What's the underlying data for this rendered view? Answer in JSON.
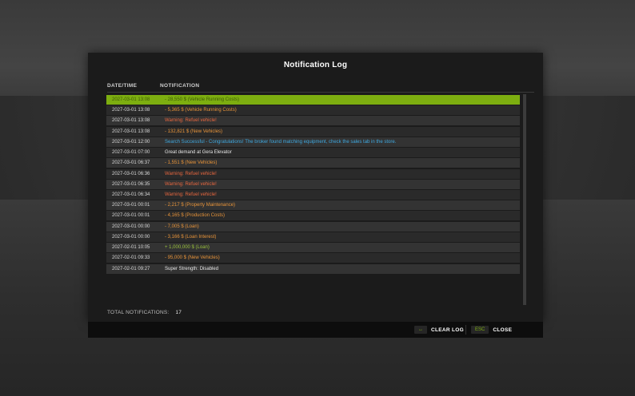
{
  "dialog": {
    "title": "Notification Log",
    "columns": {
      "date": "DATE/TIME",
      "notification": "NOTIFICATION"
    }
  },
  "colors": {
    "accent": "#7dae10",
    "white": "#e6e6e6",
    "expense": "#e8943a",
    "warning": "#e8673f",
    "info": "#3fa9e0",
    "income": "#9ac23c"
  },
  "notifications": [
    {
      "date": "2027-03-01 13:08",
      "message": "- 28,550 $ (Vehicle Running Costs)",
      "kind": "selected"
    },
    {
      "date": "2027-03-01 13:08",
      "message": "- 5,365 $ (Vehicle Running Costs)",
      "kind": "expense"
    },
    {
      "date": "2027-03-01 13:08",
      "message": "Warning: Refuel vehicle!",
      "kind": "warning"
    },
    {
      "date": "2027-03-01 13:08",
      "message": "- 132,821 $ (New Vehicles)",
      "kind": "expense"
    },
    {
      "date": "2027-03-01 12:00",
      "message": "Search Successful - Congratulations! The broker found matching equipment, check the sales tab in the store.",
      "kind": "info"
    },
    {
      "date": "2027-03-01 07:00",
      "message": "Great demand at Gera Elevator",
      "kind": "plain"
    },
    {
      "date": "2027-03-01 06:37",
      "message": "- 1,551 $ (New Vehicles)",
      "kind": "expense"
    },
    {
      "date": "2027-03-01 06:36",
      "message": "Warning: Refuel vehicle!",
      "kind": "warning"
    },
    {
      "date": "2027-03-01 06:35",
      "message": "Warning: Refuel vehicle!",
      "kind": "warning"
    },
    {
      "date": "2027-03-01 06:34",
      "message": "Warning: Refuel vehicle!",
      "kind": "warning"
    },
    {
      "date": "2027-03-01 00:01",
      "message": "- 2,217 $ (Property Maintenance)",
      "kind": "expense"
    },
    {
      "date": "2027-03-01 00:01",
      "message": "- 4,165 $ (Production Costs)",
      "kind": "expense"
    },
    {
      "date": "2027-03-01 00:00",
      "message": "- 7,005 $ (Loan)",
      "kind": "expense"
    },
    {
      "date": "2027-03-01 00:00",
      "message": "- 3,166 $ (Loan Interest)",
      "kind": "expense"
    },
    {
      "date": "2027-02-01 10:05",
      "message": "+ 1,000,000 $ (Loan)",
      "kind": "income"
    },
    {
      "date": "2027-02-01 09:33",
      "message": "- 95,000 $ (New Vehicles)",
      "kind": "expense"
    },
    {
      "date": "2027-02-01 09:27",
      "message": "Super Strength: Disabled",
      "kind": "plain"
    }
  ],
  "total": {
    "label": "TOTAL NOTIFICATIONS:",
    "value": "17"
  },
  "footer": {
    "clear": {
      "key_icon": "↔",
      "key_icon_name": "arrows-horizontal-icon",
      "label": "CLEAR LOG"
    },
    "close": {
      "key": "ESC",
      "label": "CLOSE"
    }
  }
}
